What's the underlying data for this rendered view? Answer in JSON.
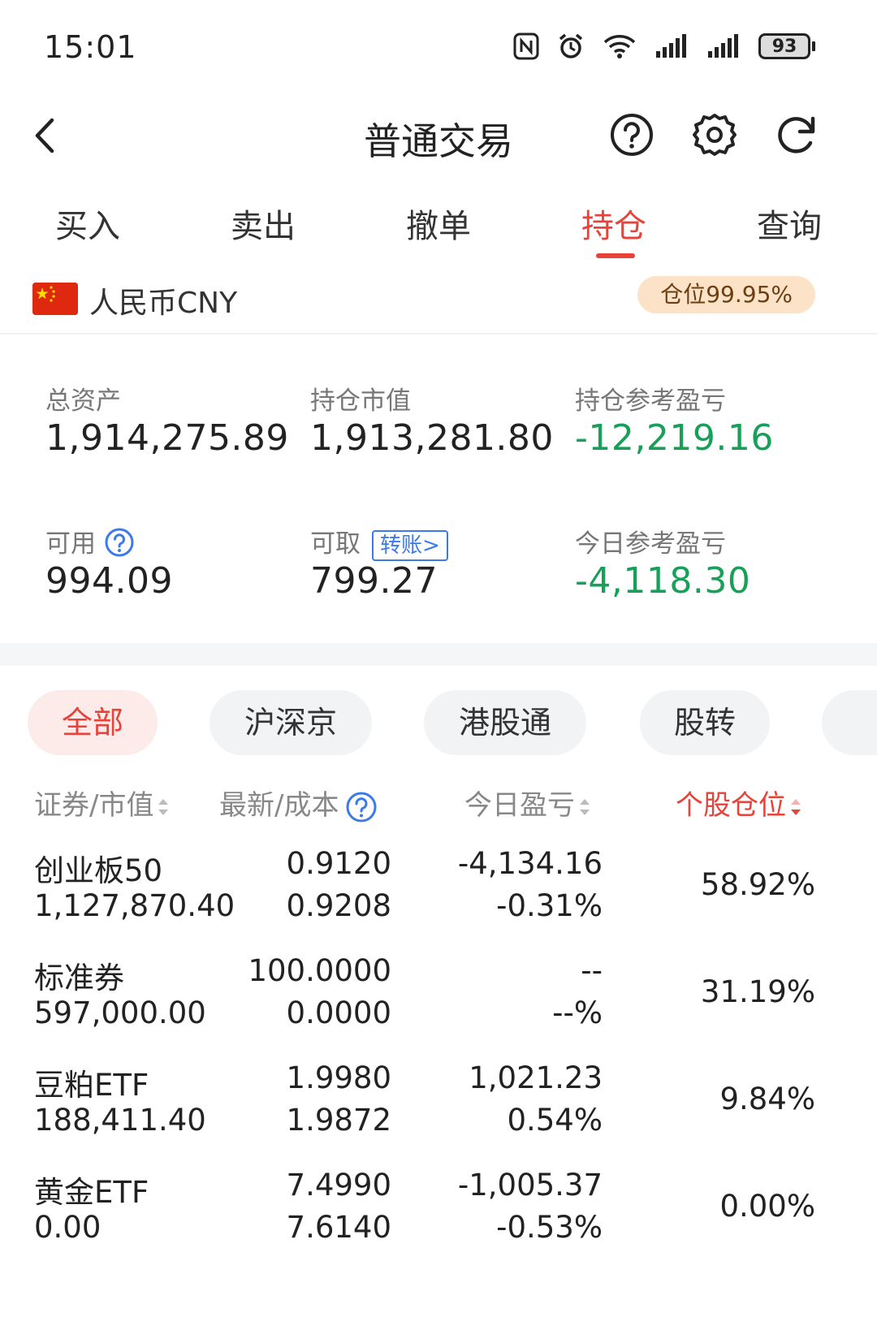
{
  "status_bar": {
    "time": "15:01",
    "battery": "93"
  },
  "header": {
    "title": "普通交易",
    "back_icon": "chevron-left-icon",
    "help_icon": "question-icon",
    "settings_icon": "gear-icon",
    "refresh_icon": "refresh-icon"
  },
  "tabs": [
    {
      "label": "买入"
    },
    {
      "label": "卖出"
    },
    {
      "label": "撤单"
    },
    {
      "label": "持仓"
    },
    {
      "label": "查询"
    }
  ],
  "active_tab": "持仓",
  "currency": {
    "label": "人民币CNY",
    "position_badge": "仓位99.95%"
  },
  "summary": {
    "total_assets_label": "总资产",
    "total_assets": "1,914,275.89",
    "market_value_label": "持仓市值",
    "market_value": "1,913,281.80",
    "holding_pl_label": "持仓参考盈亏",
    "holding_pl": "-12,219.16",
    "available_label": "可用",
    "available": "994.09",
    "withdrawable_label": "可取",
    "withdrawable": "799.27",
    "transfer_label": "转账>",
    "today_pl_label": "今日参考盈亏",
    "today_pl": "-4,118.30"
  },
  "filters": [
    {
      "label": "全部"
    },
    {
      "label": "沪深京"
    },
    {
      "label": "港股通"
    },
    {
      "label": "股转"
    }
  ],
  "table": {
    "headers": {
      "security": "证券/市值",
      "latest_cost": "最新/成本",
      "today_pl": "今日盈亏",
      "weight": "个股仓位"
    },
    "rows": [
      {
        "name": "创业板50",
        "market_value": "1,127,870.40",
        "latest": "0.9120",
        "cost": "0.9208",
        "pl": "-4,134.16",
        "pl_pct": "-0.31%",
        "weight": "58.92%",
        "tone": "green"
      },
      {
        "name": "标准券",
        "market_value": "597,000.00",
        "latest": "100.0000",
        "cost": "0.0000",
        "pl": "--",
        "pl_pct": "--%",
        "weight": "31.19%",
        "tone": "neutral"
      },
      {
        "name": "豆粕ETF",
        "market_value": "188,411.40",
        "latest": "1.9980",
        "cost": "1.9872",
        "pl": "1,021.23",
        "pl_pct": "0.54%",
        "weight": "9.84%",
        "tone": "red"
      },
      {
        "name": "黄金ETF",
        "market_value": "0.00",
        "latest": "7.4990",
        "cost": "7.6140",
        "pl": "-1,005.37",
        "pl_pct": "-0.53%",
        "weight": "0.00%",
        "tone": "green"
      }
    ]
  },
  "colors": {
    "accent_red": "#e8433a",
    "loss_green": "#18a058",
    "badge_bg": "#fce3c8",
    "link_blue": "#3b7ae8"
  }
}
